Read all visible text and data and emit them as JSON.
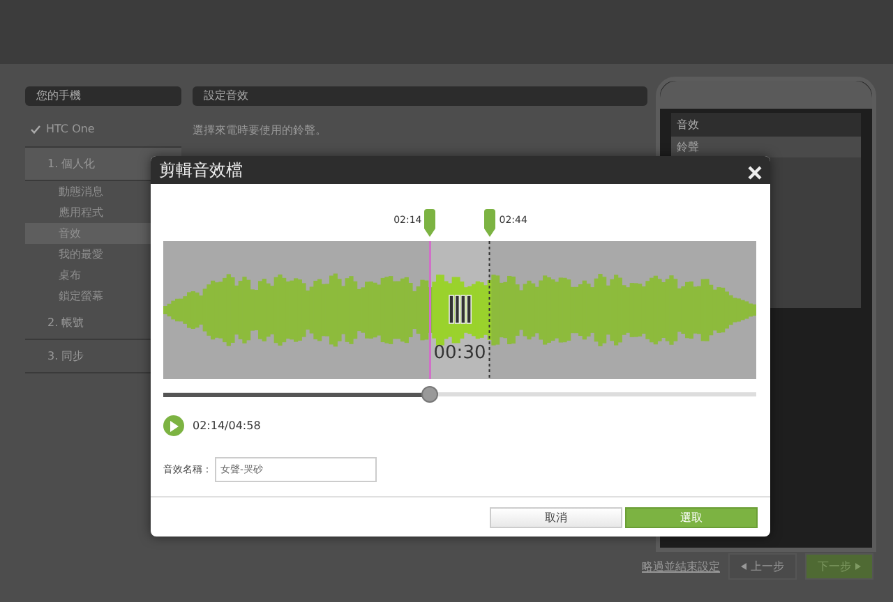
{
  "page": {
    "sidebar": {
      "title": "您的手機",
      "device": "HTC One",
      "steps": [
        {
          "label": "1. 個人化",
          "expanded": true,
          "children": [
            {
              "label": "動態消息",
              "selected": false
            },
            {
              "label": "應用程式",
              "selected": false
            },
            {
              "label": "音效",
              "selected": true
            },
            {
              "label": "我的最愛",
              "selected": false
            },
            {
              "label": "桌布",
              "selected": false
            },
            {
              "label": "鎖定螢幕",
              "selected": false
            }
          ]
        },
        {
          "label": "2. 帳號",
          "expanded": false
        },
        {
          "label": "3. 同步",
          "expanded": false
        }
      ]
    },
    "content": {
      "title": "設定音效",
      "instruction": "選擇來電時要使用的鈴聲。"
    },
    "phone_screen": {
      "title": "音效",
      "items": [
        "鈴聲"
      ]
    },
    "footer": {
      "skip_link": "略過並結束設定",
      "back_button": "上一步",
      "next_button": "下一步"
    }
  },
  "dialog": {
    "title": "剪輯音效檔",
    "markers": [
      {
        "label": "02:14",
        "level": 0.45
      },
      {
        "label": "02:44",
        "level": 0.55
      }
    ],
    "selection_duration": "00:30",
    "playback": {
      "level": 0.45,
      "time": "02:14/04:58",
      "playing": false
    },
    "name_field": {
      "label": "音效名稱：",
      "value": "女聲-哭砂"
    },
    "buttons": [
      {
        "label": "取消",
        "kind": "secondary"
      },
      {
        "label": "選取",
        "kind": "primary"
      }
    ]
  }
}
